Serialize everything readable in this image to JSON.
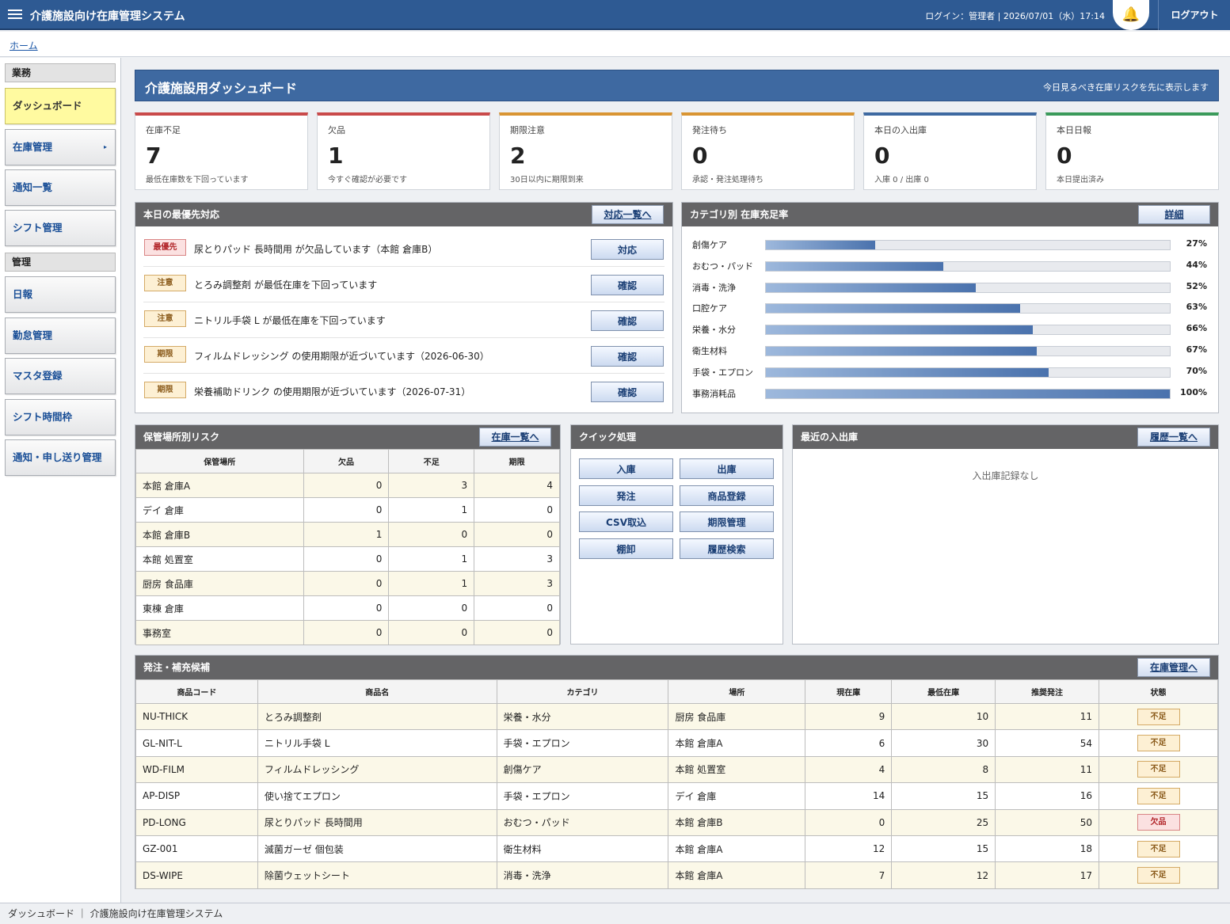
{
  "app": {
    "title": "介護施設向け在庫管理システム",
    "login": "ログイン：管理者 | 2026/07/01（水）17:14",
    "logout": "ログアウト",
    "bell": "🔔"
  },
  "breadcrumb": {
    "home": "ホーム"
  },
  "sidebar": {
    "section_work": "業務",
    "section_admin": "管理",
    "items": [
      {
        "label": "ダッシュボード"
      },
      {
        "label": "在庫管理",
        "arrow": "▸"
      },
      {
        "label": "通知一覧"
      },
      {
        "label": "シフト管理"
      },
      {
        "label": "日報"
      },
      {
        "label": "勤怠管理"
      },
      {
        "label": "マスタ登録"
      },
      {
        "label": "シフト時間枠"
      },
      {
        "label": "通知・申し送り管理"
      }
    ]
  },
  "dashboard": {
    "title": "介護施設用ダッシュボード",
    "subtitle": "今日見るべき在庫リスクを先に表示します"
  },
  "colors": {
    "red": "#c94a4a",
    "orange": "#d99533",
    "blue": "#3e69a1",
    "green": "#3a9a5a"
  },
  "kpis": [
    {
      "label": "在庫不足",
      "value": "7",
      "note": "最低在庫数を下回っています"
    },
    {
      "label": "欠品",
      "value": "1",
      "note": "今すぐ確認が必要です"
    },
    {
      "label": "期限注意",
      "value": "2",
      "note": "30日以内に期限到来"
    },
    {
      "label": "発注待ち",
      "value": "0",
      "note": "承認・発注処理待ち"
    },
    {
      "label": "本日の入出庫",
      "value": "0",
      "note": "入庫 0 / 出庫 0"
    },
    {
      "label": "本日日報",
      "value": "0",
      "note": "本日提出済み"
    }
  ],
  "priority": {
    "title": "本日の最優先対応",
    "link": "対応一覧へ",
    "items": [
      {
        "tag": "最優先",
        "message": "尿とりパッド 長時間用 が欠品しています（本館 倉庫B）",
        "action": "対応"
      },
      {
        "tag": "注意",
        "message": "とろみ調整剤 が最低在庫を下回っています",
        "action": "確認"
      },
      {
        "tag": "注意",
        "message": "ニトリル手袋 L が最低在庫を下回っています",
        "action": "確認"
      },
      {
        "tag": "期限",
        "message": "フィルムドレッシング の使用期限が近づいています（2026-06-30）",
        "action": "確認"
      },
      {
        "tag": "期限",
        "message": "栄養補助ドリンク の使用期限が近づいています（2026-07-31）",
        "action": "確認"
      }
    ]
  },
  "category": {
    "title": "カテゴリ別 在庫充足率",
    "link": "詳細",
    "items": [
      {
        "name": "創傷ケア",
        "percent": 27,
        "label": "27%"
      },
      {
        "name": "おむつ・パッド",
        "percent": 44,
        "label": "44%"
      },
      {
        "name": "消毒・洗浄",
        "percent": 52,
        "label": "52%"
      },
      {
        "name": "口腔ケア",
        "percent": 63,
        "label": "63%"
      },
      {
        "name": "栄養・水分",
        "percent": 66,
        "label": "66%"
      },
      {
        "name": "衛生材料",
        "percent": 67,
        "label": "67%"
      },
      {
        "name": "手袋・エプロン",
        "percent": 70,
        "label": "70%"
      },
      {
        "name": "事務消耗品",
        "percent": 100,
        "label": "100%"
      }
    ]
  },
  "location_risk": {
    "title": "保管場所別リスク",
    "link": "在庫一覧へ",
    "headers": [
      "保管場所",
      "欠品",
      "不足",
      "期限"
    ],
    "rows": [
      [
        "本館 倉庫A",
        "0",
        "3",
        "4"
      ],
      [
        "デイ 倉庫",
        "0",
        "1",
        "0"
      ],
      [
        "本館 倉庫B",
        "1",
        "0",
        "0"
      ],
      [
        "本館 処置室",
        "0",
        "1",
        "3"
      ],
      [
        "厨房 食品庫",
        "0",
        "1",
        "3"
      ],
      [
        "東棟 倉庫",
        "0",
        "0",
        "0"
      ],
      [
        "事務室",
        "0",
        "0",
        "0"
      ]
    ]
  },
  "quick": {
    "title": "クイック処理",
    "buttons": [
      "入庫",
      "出庫",
      "発注",
      "商品登録",
      "CSV取込",
      "期限管理",
      "棚卸",
      "履歴検索"
    ]
  },
  "recent": {
    "title": "最近の入出庫",
    "link": "履歴一覧へ",
    "empty": "入出庫記録なし"
  },
  "reorder": {
    "title": "発注・補充候補",
    "link": "在庫管理へ",
    "headers": [
      "商品コード",
      "商品名",
      "カテゴリ",
      "場所",
      "現在庫",
      "最低在庫",
      "推奨発注",
      "状態"
    ],
    "rows": [
      {
        "code": "NU-THICK",
        "name": "とろみ調整剤",
        "category": "栄養・水分",
        "location": "厨房 食品庫",
        "stock": "9",
        "min": "10",
        "order": "11",
        "status": "不足"
      },
      {
        "code": "GL-NIT-L",
        "name": "ニトリル手袋 L",
        "category": "手袋・エプロン",
        "location": "本館 倉庫A",
        "stock": "6",
        "min": "30",
        "order": "54",
        "status": "不足"
      },
      {
        "code": "WD-FILM",
        "name": "フィルムドレッシング",
        "category": "創傷ケア",
        "location": "本館 処置室",
        "stock": "4",
        "min": "8",
        "order": "11",
        "status": "不足"
      },
      {
        "code": "AP-DISP",
        "name": "使い捨てエプロン",
        "category": "手袋・エプロン",
        "location": "デイ 倉庫",
        "stock": "14",
        "min": "15",
        "order": "16",
        "status": "不足"
      },
      {
        "code": "PD-LONG",
        "name": "尿とりパッド 長時間用",
        "category": "おむつ・パッド",
        "location": "本館 倉庫B",
        "stock": "0",
        "min": "25",
        "order": "50",
        "status": "欠品"
      },
      {
        "code": "GZ-001",
        "name": "滅菌ガーゼ 個包装",
        "category": "衛生材料",
        "location": "本館 倉庫A",
        "stock": "12",
        "min": "15",
        "order": "18",
        "status": "不足"
      },
      {
        "code": "DS-WIPE",
        "name": "除菌ウェットシート",
        "category": "消毒・洗浄",
        "location": "本館 倉庫A",
        "stock": "7",
        "min": "12",
        "order": "17",
        "status": "不足"
      }
    ]
  },
  "statusbar": {
    "text": "ダッシュボード ｜ 介護施設向け在庫管理システム"
  }
}
